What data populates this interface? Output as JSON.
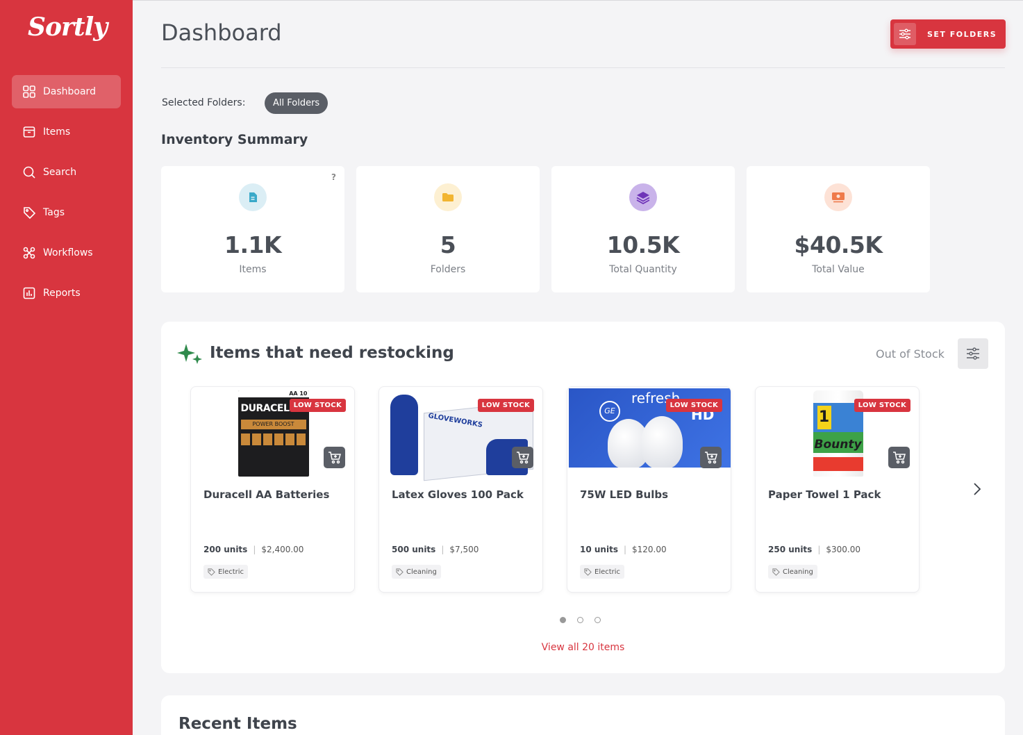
{
  "brand": {
    "logo_text": "Sortly"
  },
  "sidebar": {
    "items": [
      {
        "label": "Dashboard",
        "icon": "grid-icon",
        "active": true
      },
      {
        "label": "Items",
        "icon": "box-icon",
        "active": false
      },
      {
        "label": "Search",
        "icon": "search-icon",
        "active": false
      },
      {
        "label": "Tags",
        "icon": "tag-icon",
        "active": false
      },
      {
        "label": "Workflows",
        "icon": "workflow-icon",
        "active": false
      },
      {
        "label": "Reports",
        "icon": "chart-icon",
        "active": false
      }
    ]
  },
  "header": {
    "title": "Dashboard",
    "set_folders_label": "SET FOLDERS"
  },
  "folders": {
    "label": "Selected Folders:",
    "chip": "All Folders"
  },
  "summary": {
    "title": "Inventory Summary",
    "help": "?",
    "cards": [
      {
        "value": "1.1K",
        "label": "Items",
        "icon": "document-icon",
        "color": "#3aa9c9",
        "bg": "#dbeef5"
      },
      {
        "value": "5",
        "label": "Folders",
        "icon": "folder-icon",
        "color": "#f2b531",
        "bg": "#fdf0d2"
      },
      {
        "value": "10.5K",
        "label": "Total Quantity",
        "icon": "layers-icon",
        "color": "#8a4fd0",
        "bg": "#e3d6f3"
      },
      {
        "value": "$40.5K",
        "label": "Total Value",
        "icon": "money-icon",
        "color": "#ef7a4a",
        "bg": "#fde2d6"
      }
    ]
  },
  "restock": {
    "title": "Items that need restocking",
    "filter_label": "Out of Stock",
    "items": [
      {
        "name": "Duracell AA Batteries",
        "badge": "LOW STOCK",
        "units": "200 units",
        "price": "$2,400.00",
        "tag": "Electric",
        "brand_text": "DURACELL",
        "sub_text": "POWER BOOST",
        "corner_text": "AA 10"
      },
      {
        "name": "Latex Gloves 100 Pack",
        "badge": "LOW STOCK",
        "units": "500 units",
        "price": "$7,500",
        "tag": "Cleaning",
        "brand_text": "GLOVEWORKS"
      },
      {
        "name": "75W LED Bulbs",
        "badge": "LOW STOCK",
        "units": "10 units",
        "price": "$120.00",
        "tag": "Electric",
        "brand_text": "refresh",
        "sub_text": "HD"
      },
      {
        "name": "Paper Towel 1 Pack",
        "badge": "LOW STOCK",
        "units": "250 units",
        "price": "$300.00",
        "tag": "Cleaning",
        "brand_text": "Bounty",
        "sub_text": "1"
      }
    ],
    "view_all": "View all 20 items",
    "pages": 3,
    "current_page": 1
  },
  "recent": {
    "title": "Recent Items"
  },
  "colors": {
    "accent": "#d8353f",
    "dark_chip": "#5a5e66"
  }
}
